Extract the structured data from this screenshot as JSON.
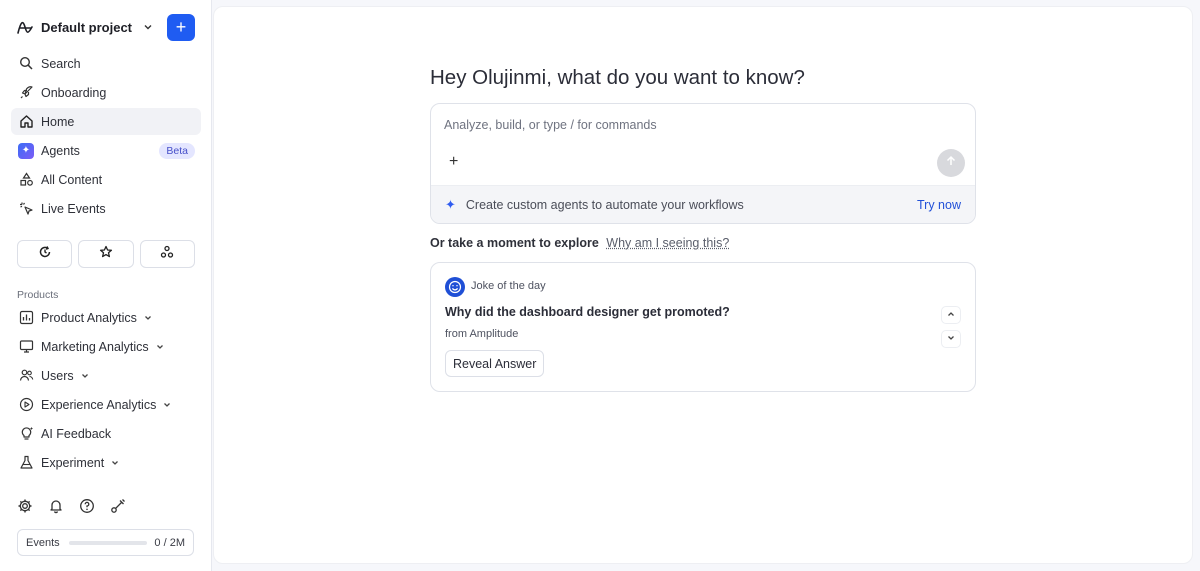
{
  "project": {
    "name": "Default project",
    "add_label": "+"
  },
  "nav": [
    {
      "label": "Search",
      "icon": "search-icon"
    },
    {
      "label": "Onboarding",
      "icon": "rocket-icon"
    },
    {
      "label": "Home",
      "icon": "home-icon",
      "active": true
    },
    {
      "label": "Agents",
      "icon": "sparkle-icon",
      "badge": "Beta"
    },
    {
      "label": "All Content",
      "icon": "shapes-icon"
    },
    {
      "label": "Live Events",
      "icon": "cursor-click-icon"
    }
  ],
  "quick_actions": [
    "recent-icon",
    "star-icon",
    "spaces-icon"
  ],
  "products": {
    "label": "Products",
    "items": [
      {
        "label": "Product Analytics",
        "icon": "bar-chart-icon",
        "expandable": true
      },
      {
        "label": "Marketing Analytics",
        "icon": "monitor-icon",
        "expandable": true
      },
      {
        "label": "Users",
        "icon": "users-icon",
        "expandable": true
      },
      {
        "label": "Experience Analytics",
        "icon": "play-circle-icon",
        "expandable": true
      },
      {
        "label": "AI Feedback",
        "icon": "lightbulb-icon",
        "expandable": false
      },
      {
        "label": "Experiment",
        "icon": "flask-icon",
        "expandable": true
      }
    ]
  },
  "footer_icons": [
    "gear-icon",
    "bell-icon",
    "help-icon",
    "tools-icon"
  ],
  "events": {
    "label": "Events",
    "count": "0 / 2M",
    "progress": 0
  },
  "main": {
    "greeting": "Hey Olujinmi, what do you want to know?",
    "prompt_placeholder": "Analyze, build, or type / for commands",
    "agents_promo": "Create custom agents to automate your workflows",
    "try_now": "Try now",
    "explore_text": "Or take a moment to explore",
    "why_text": "Why am I seeing this?",
    "card": {
      "label": "Joke of the day",
      "question": "Why did the dashboard designer get promoted?",
      "from": "from Amplitude",
      "reveal": "Reveal Answer"
    }
  },
  "colors": {
    "accent": "#1f5cf2",
    "badge_bg": "#e4e6ff",
    "badge_fg": "#4750c9"
  }
}
